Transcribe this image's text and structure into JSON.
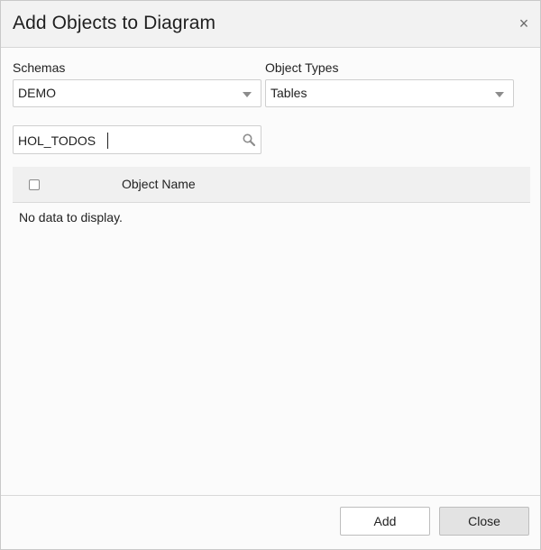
{
  "dialog": {
    "title": "Add Objects to Diagram",
    "close_icon": "close-icon"
  },
  "filters": {
    "schemas": {
      "label": "Schemas",
      "value": "DEMO"
    },
    "object_types": {
      "label": "Object Types",
      "value": "Tables"
    }
  },
  "search": {
    "value": "HOL_TODOS",
    "icon": "search-icon"
  },
  "grid": {
    "columns": [
      "Object Name"
    ],
    "empty_message": "No data to display."
  },
  "footer": {
    "add_label": "Add",
    "close_label": "Close"
  }
}
